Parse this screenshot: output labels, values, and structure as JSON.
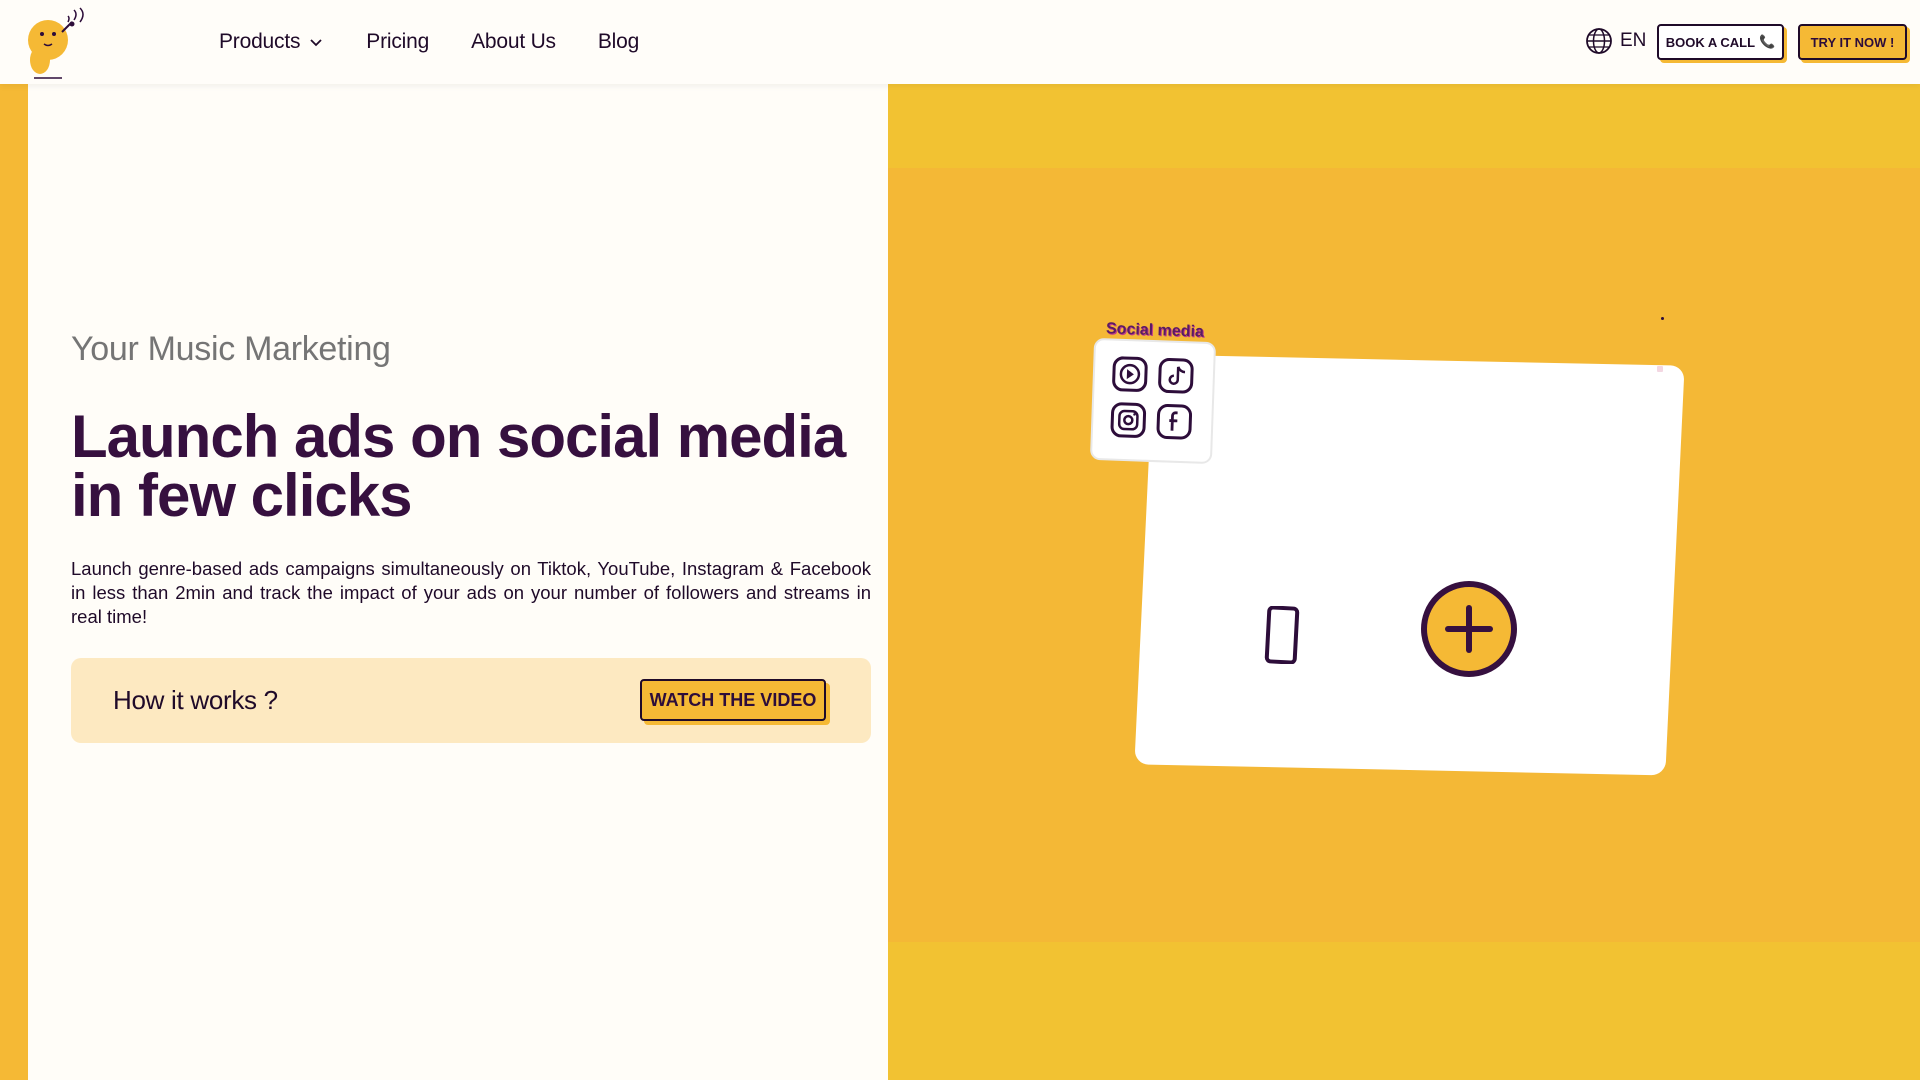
{
  "nav": {
    "items": [
      {
        "label": "Products",
        "has_dropdown": true
      },
      {
        "label": "Pricing"
      },
      {
        "label": "About Us"
      },
      {
        "label": "Blog"
      }
    ],
    "language": "EN",
    "book_call_label": "BOOK A CALL",
    "try_label": "TRY IT NOW !"
  },
  "hero": {
    "eyebrow": "Your Music Marketing",
    "headline": "Launch ads on social media in few clicks",
    "description": "Launch genre-based ads campaigns simultaneously on Tiktok, YouTube, Instagram & Facebook in less than 2min and track the impact of your ads on your number of followers and streams in real time!",
    "how_label": "How it works ?",
    "video_button": "WATCH THE VIDEO"
  },
  "illustration": {
    "social_label": "Social media",
    "icons": [
      "youtube-icon",
      "tiktok-icon",
      "instagram-icon",
      "facebook-icon"
    ]
  },
  "colors": {
    "accent": "#f5b935",
    "dark": "#36103f",
    "light_bg": "#fffdf8",
    "box_bg": "#fde9c1"
  }
}
